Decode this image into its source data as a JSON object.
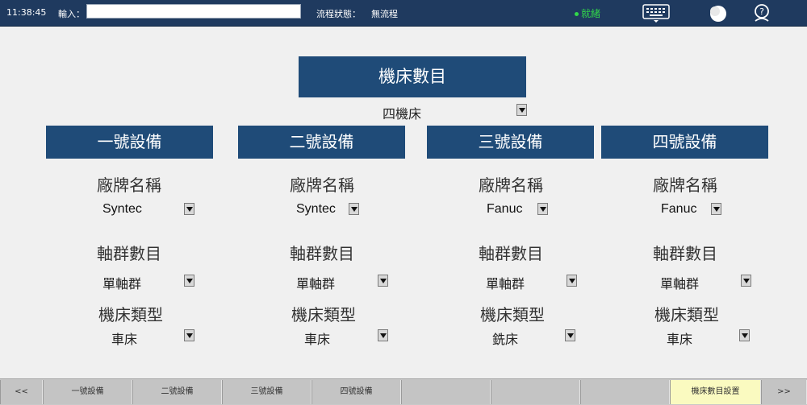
{
  "topbar": {
    "time": "11:38:45",
    "input_label": "輸入：",
    "input_value": "",
    "flow_label": "流程狀態：",
    "flow_value": "無流程",
    "status": "就緒",
    "status_color": "#32d84a",
    "icons": [
      "keyboard-icon",
      "moon-icon",
      "help-icon"
    ]
  },
  "machine_count": {
    "header": "機床數目",
    "value": "四機床"
  },
  "devices": [
    {
      "header": "一號設備",
      "brand_label": "廠牌名稱",
      "brand": "Syntec",
      "axis_label": "軸群數目",
      "axis": "單軸群",
      "type_label": "機床類型",
      "type": "車床"
    },
    {
      "header": "二號設備",
      "brand_label": "廠牌名稱",
      "brand": "Syntec",
      "axis_label": "軸群數目",
      "axis": "單軸群",
      "type_label": "機床類型",
      "type": "車床"
    },
    {
      "header": "三號設備",
      "brand_label": "廠牌名稱",
      "brand": "Fanuc",
      "axis_label": "軸群數目",
      "axis": "單軸群",
      "type_label": "機床類型",
      "type": "銑床"
    },
    {
      "header": "四號設備",
      "brand_label": "廠牌名稱",
      "brand": "Fanuc",
      "axis_label": "軸群數目",
      "axis": "單軸群",
      "type_label": "機床類型",
      "type": "車床"
    }
  ],
  "bottom_nav": {
    "prev": "<<",
    "items": [
      "一號設備",
      "二號設備",
      "三號設備",
      "四號設備",
      "",
      "",
      "",
      "機床數目設置"
    ],
    "next": ">>"
  },
  "colors": {
    "header_bg": "#1f4b78",
    "topbar_bg": "#1f3a5f",
    "active_tab": "#fafac0"
  }
}
